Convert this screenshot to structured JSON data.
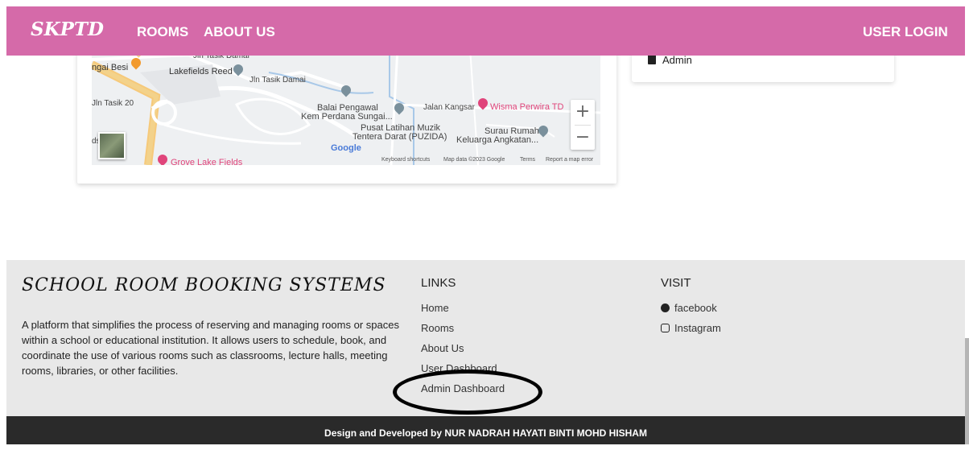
{
  "navbar": {
    "brand": "SKPTD",
    "links": [
      "ROOMS",
      "ABOUT US"
    ],
    "login": "USER LOGIN",
    "color": "#d56aa9"
  },
  "map": {
    "labels": [
      "Jln Tasik Damai",
      "Lakefields Reed",
      "Jln Tasik Damai",
      "Jln Tasik 20",
      "Balai Pengawal",
      "Kem Perdana Sungai...",
      "Jalan Kangsar",
      "Pusat Latihan Muzik",
      "Tentera Darat (PUZIDA)",
      "Surau Rumah",
      "Keluarga Angkatan...",
      "ngai Besi",
      "ds"
    ],
    "pois": [
      "Wisma Perwira TD",
      "Grove Lake Fields"
    ],
    "zoom_in": "+",
    "zoom_out": "−",
    "google": "Google",
    "footer": [
      "Keyboard shortcuts",
      "Map data ©2023 Google",
      "Terms",
      "Report a map error"
    ]
  },
  "side_card": {
    "admin": "Admin"
  },
  "footer": {
    "title": "SCHOOL ROOM BOOKING SYSTEMS",
    "description": "A platform that simplifies the process of reserving and managing rooms or spaces within a school or educational institution. It allows users to schedule, book, and coordinate the use of various rooms such as classrooms, lecture halls, meeting rooms, libraries, or other facilities.",
    "links_heading": "LINKS",
    "links": [
      "Home",
      "Rooms",
      "About Us",
      "User Dashboard",
      "Admin Dashboard"
    ],
    "visit_heading": "VISIT",
    "visit": [
      "facebook",
      "Instagram"
    ]
  },
  "bottom_bar": {
    "credit": "Design and Developed by NUR NADRAH HAYATI BINTI MOHD HISHAM"
  }
}
